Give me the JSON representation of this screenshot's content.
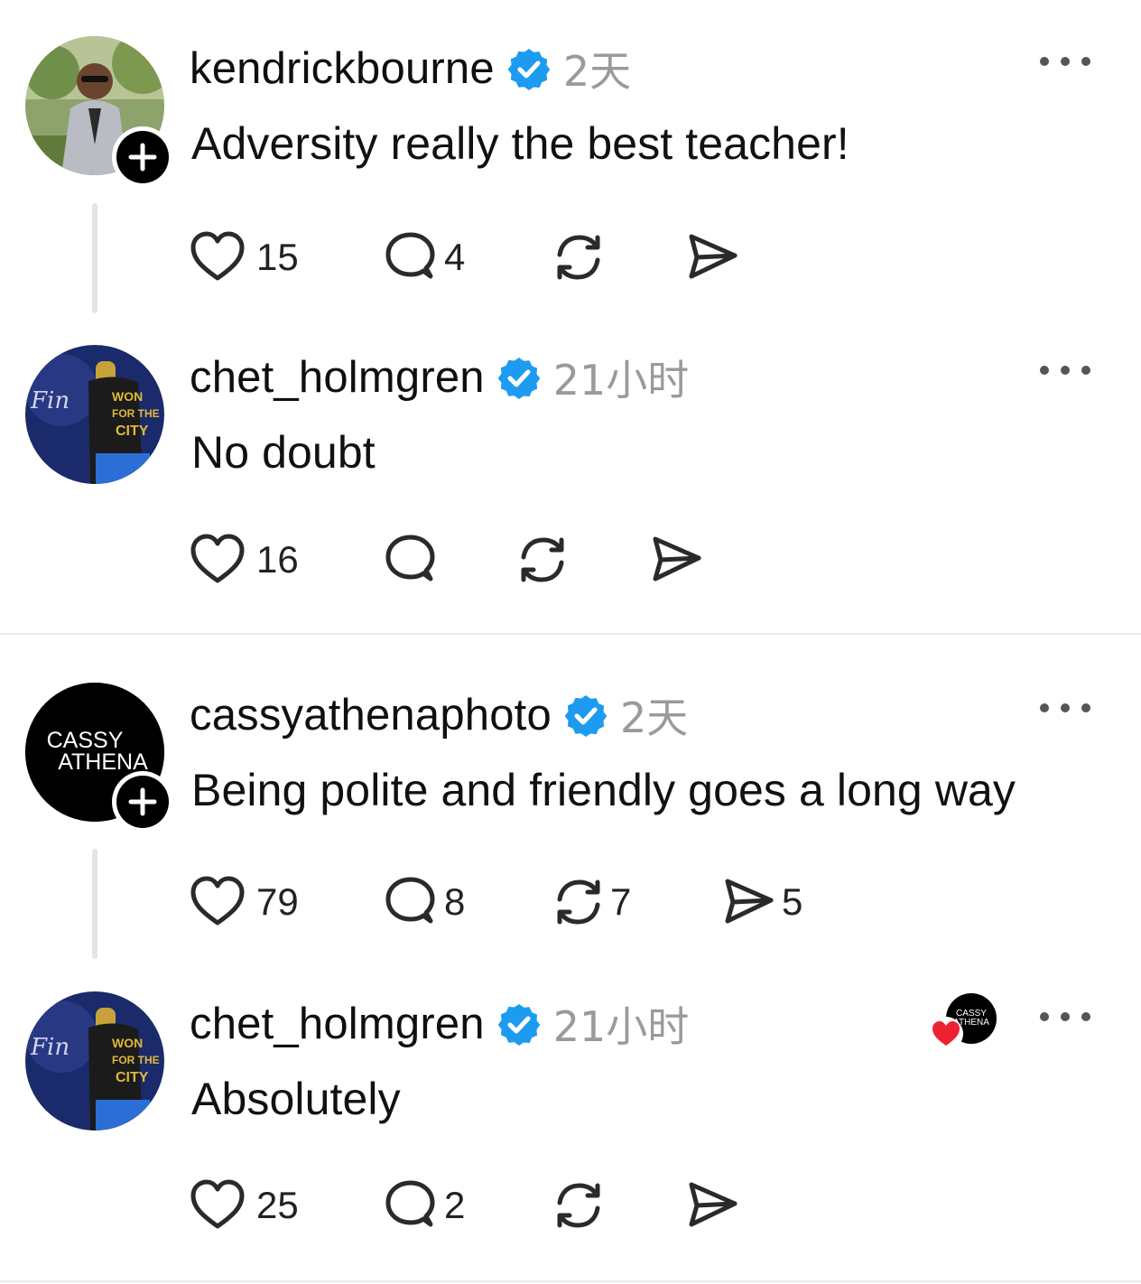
{
  "posts": [
    {
      "username": "kendrickbourne",
      "time": "2天",
      "text": "Adversity really the best teacher!",
      "likes": "15",
      "comments": "4",
      "reposts": "",
      "shares": ""
    },
    {
      "username": "chet_holmgren",
      "time": "21小时",
      "text": "No doubt",
      "likes": "16",
      "comments": "",
      "reposts": "",
      "shares": ""
    },
    {
      "username": "cassyathenaphoto",
      "time": "2天",
      "text": "Being polite and friendly goes a long way",
      "likes": "79",
      "comments": "8",
      "reposts": "7",
      "shares": "5",
      "avatar_text": [
        "CASSY",
        "ATHENA"
      ]
    },
    {
      "username": "chet_holmgren",
      "time": "21小时",
      "text": "Absolutely",
      "likes": "25",
      "comments": "2",
      "reposts": "",
      "shares": ""
    }
  ],
  "liked_by_author_badge": [
    "CASSY",
    "ATHENA"
  ],
  "colors": {
    "verified": "#1d9bf0",
    "heart_badge": "#ee2233",
    "muted": "#9a9a9a"
  },
  "icons": {
    "like": "heart-icon",
    "comment": "comment-bubble-icon",
    "repost": "repost-icon",
    "share": "send-icon",
    "more": "more-horizontal-icon",
    "follow": "plus-icon",
    "verified": "verified-badge-icon"
  }
}
